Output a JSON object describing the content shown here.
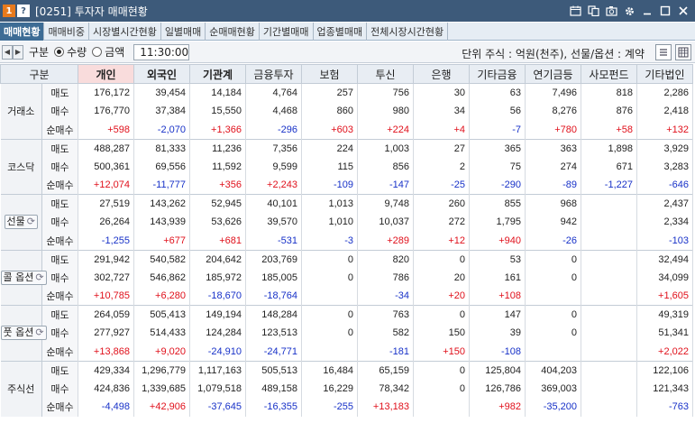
{
  "window": {
    "badge_one": "1",
    "badge_q": "?",
    "title": "[0251] 투자자 매매현황",
    "icons": [
      "calendar-icon",
      "copy-icon",
      "camera-icon",
      "gear-icon",
      "minimize-icon",
      "maximize-icon",
      "close-icon"
    ]
  },
  "tabs": [
    {
      "label": "매매현황",
      "active": true
    },
    {
      "label": "매매비중",
      "active": false
    },
    {
      "label": "시장별시간현황",
      "active": false
    },
    {
      "label": "일별매매",
      "active": false
    },
    {
      "label": "순매매현황",
      "active": false
    },
    {
      "label": "기간별매매",
      "active": false
    },
    {
      "label": "업종별매매",
      "active": false
    },
    {
      "label": "전체시장시간현황",
      "active": false
    }
  ],
  "toolbar": {
    "gubun_label": "구분",
    "radio_qty": "수량",
    "radio_amount": "금액",
    "selected": "qty",
    "time": "11:30:00",
    "unit_text": "단위 주식 : 억원(천주), 선물/옵션 : 계약"
  },
  "table": {
    "headers": [
      "구분",
      "개인",
      "외국인",
      "기관계",
      "금융투자",
      "보험",
      "투신",
      "은행",
      "기타금융",
      "연기금등",
      "사모펀드",
      "기타법인"
    ],
    "row_types": [
      "매도",
      "매수",
      "순매수"
    ],
    "groups": [
      {
        "name": "거래소",
        "button": false,
        "rows": [
          [
            "176,172",
            "39,454",
            "14,184",
            "4,764",
            "257",
            "756",
            "30",
            "63",
            "7,496",
            "818",
            "2,286"
          ],
          [
            "176,770",
            "37,384",
            "15,550",
            "4,468",
            "860",
            "980",
            "34",
            "56",
            "8,276",
            "876",
            "2,418"
          ],
          [
            "+598",
            "-2,070",
            "+1,366",
            "-296",
            "+603",
            "+224",
            "+4",
            "-7",
            "+780",
            "+58",
            "+132"
          ]
        ]
      },
      {
        "name": "코스닥",
        "button": false,
        "rows": [
          [
            "488,287",
            "81,333",
            "11,236",
            "7,356",
            "224",
            "1,003",
            "27",
            "365",
            "363",
            "1,898",
            "3,929"
          ],
          [
            "500,361",
            "69,556",
            "11,592",
            "9,599",
            "115",
            "856",
            "2",
            "75",
            "274",
            "671",
            "3,283"
          ],
          [
            "+12,074",
            "-11,777",
            "+356",
            "+2,243",
            "-109",
            "-147",
            "-25",
            "-290",
            "-89",
            "-1,227",
            "-646"
          ]
        ]
      },
      {
        "name": "선물",
        "button": true,
        "rows": [
          [
            "27,519",
            "143,262",
            "52,945",
            "40,101",
            "1,013",
            "9,748",
            "260",
            "855",
            "968",
            "",
            "2,437"
          ],
          [
            "26,264",
            "143,939",
            "53,626",
            "39,570",
            "1,010",
            "10,037",
            "272",
            "1,795",
            "942",
            "",
            "2,334"
          ],
          [
            "-1,255",
            "+677",
            "+681",
            "-531",
            "-3",
            "+289",
            "+12",
            "+940",
            "-26",
            "",
            "-103"
          ]
        ]
      },
      {
        "name": "콜 옵션",
        "button": true,
        "rows": [
          [
            "291,942",
            "540,582",
            "204,642",
            "203,769",
            "0",
            "820",
            "0",
            "53",
            "0",
            "",
            "32,494"
          ],
          [
            "302,727",
            "546,862",
            "185,972",
            "185,005",
            "0",
            "786",
            "20",
            "161",
            "0",
            "",
            "34,099"
          ],
          [
            "+10,785",
            "+6,280",
            "-18,670",
            "-18,764",
            "",
            "-34",
            "+20",
            "+108",
            "",
            "",
            "+1,605"
          ]
        ]
      },
      {
        "name": "풋 옵션",
        "button": true,
        "rows": [
          [
            "264,059",
            "505,413",
            "149,194",
            "148,284",
            "0",
            "763",
            "0",
            "147",
            "0",
            "",
            "49,319"
          ],
          [
            "277,927",
            "514,433",
            "124,284",
            "123,513",
            "0",
            "582",
            "150",
            "39",
            "0",
            "",
            "51,341"
          ],
          [
            "+13,868",
            "+9,020",
            "-24,910",
            "-24,771",
            "",
            "-181",
            "+150",
            "-108",
            "",
            "",
            "+2,022"
          ]
        ]
      },
      {
        "name": "주식선",
        "button": false,
        "rows": [
          [
            "429,334",
            "1,296,779",
            "1,117,163",
            "505,513",
            "16,484",
            "65,159",
            "0",
            "125,804",
            "404,203",
            "",
            "122,106"
          ],
          [
            "424,836",
            "1,339,685",
            "1,079,518",
            "489,158",
            "16,229",
            "78,342",
            "0",
            "126,786",
            "369,003",
            "",
            "121,343"
          ],
          [
            "-4,498",
            "+42,906",
            "-37,645",
            "-16,355",
            "-255",
            "+13,183",
            "",
            "+982",
            "-35,200",
            "",
            "-763"
          ]
        ]
      }
    ]
  },
  "colors": {
    "positive": "#e0101b",
    "negative": "#1731c8",
    "titlebar": "#3d5a7a",
    "active_tab": "#3d6c95",
    "personal_header": "#f9dcdc"
  }
}
